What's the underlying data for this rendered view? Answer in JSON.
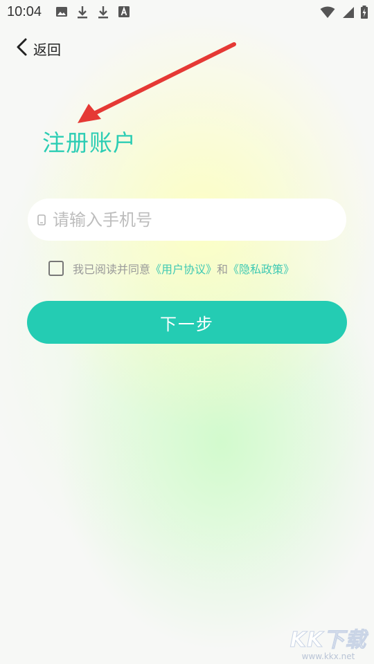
{
  "status_bar": {
    "time": "10:04",
    "left_icons": [
      "image-icon",
      "download-icon",
      "download-icon",
      "font-a-icon"
    ],
    "right_icons": [
      "wifi-icon",
      "signal-icon",
      "battery-charging-icon"
    ]
  },
  "header": {
    "back_label": "返回"
  },
  "page": {
    "title": "注册账户"
  },
  "form": {
    "phone_placeholder": "请输入手机号",
    "phone_value": "",
    "agreement_prefix": "我已阅读并同意",
    "user_agreement_link": "《用户协议》",
    "agreement_and": "和",
    "privacy_policy_link": "《隐私政策》",
    "agreement_checked": false,
    "next_label": "下一步"
  },
  "watermark": {
    "logo": "KK下载",
    "url": "www.kkx.net"
  },
  "colors": {
    "accent": "#24ccb3",
    "title": "#2ccdb4",
    "link": "#3fc9b3",
    "annotation_arrow": "#e53935"
  }
}
